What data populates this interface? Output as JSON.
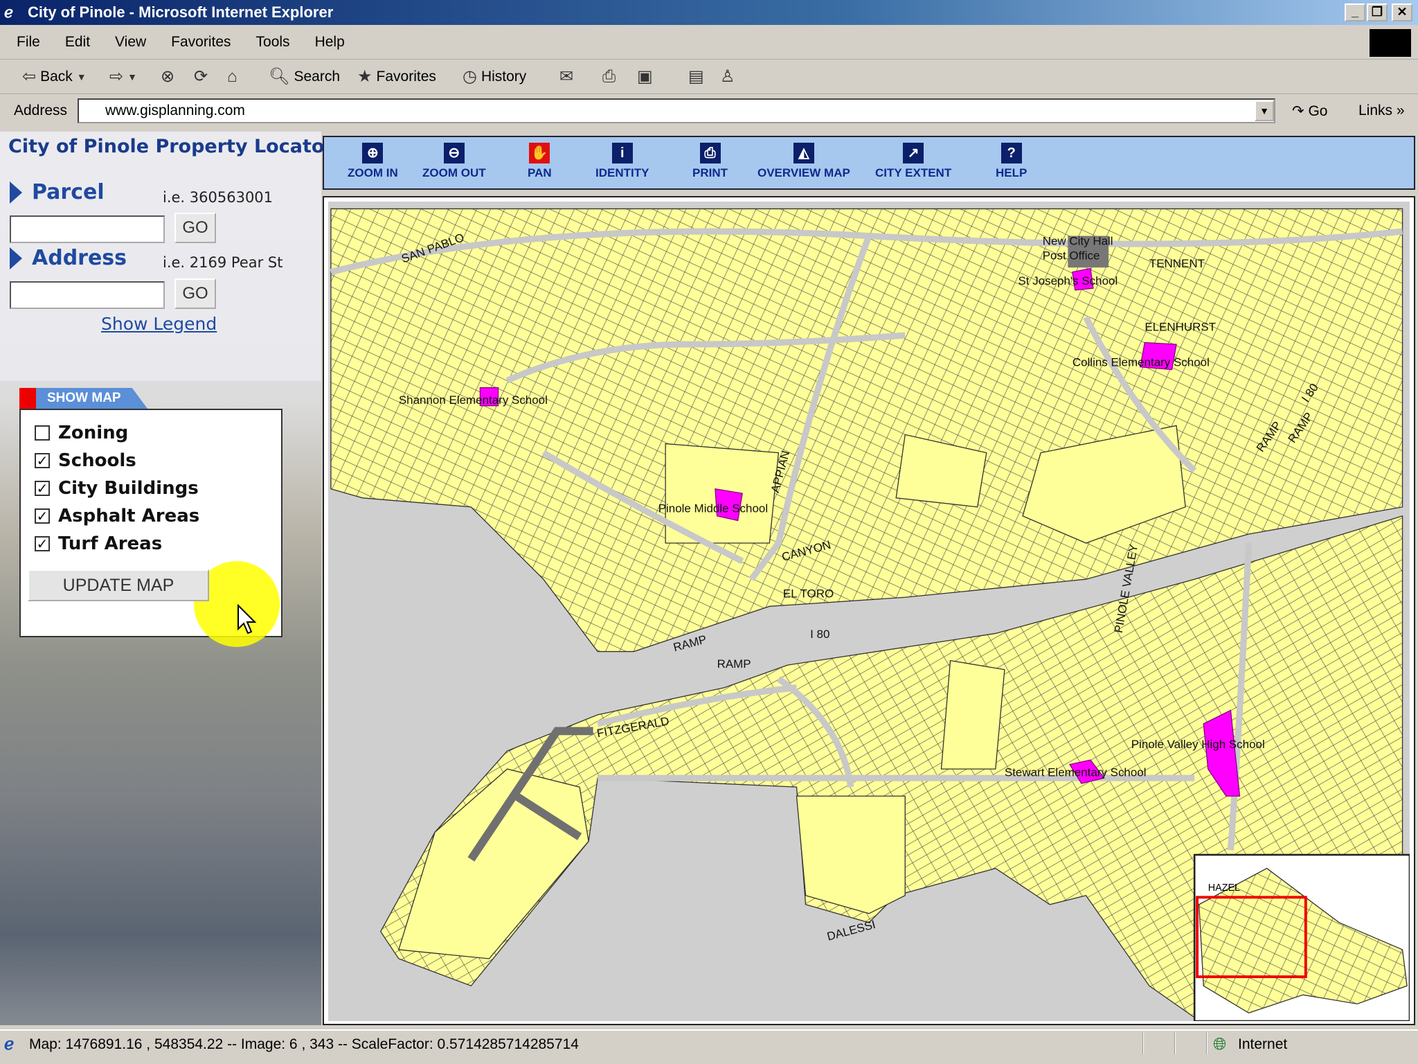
{
  "window": {
    "title": "City of Pinole - Microsoft Internet Explorer"
  },
  "menu": [
    "File",
    "Edit",
    "View",
    "Favorites",
    "Tools",
    "Help"
  ],
  "toolbar": {
    "back": "Back",
    "search": "Search",
    "favorites": "Favorites",
    "history": "History"
  },
  "address": {
    "label": "Address",
    "url": "www.gisplanning.com",
    "go": "Go",
    "links": "Links"
  },
  "app": {
    "title": "City of Pinole Property Locator",
    "parcel": {
      "label": "Parcel",
      "hint": "i.e. 360563001",
      "value": "",
      "go": "GO"
    },
    "address": {
      "label": "Address",
      "hint": "i.e. 2169 Pear St",
      "value": "",
      "go": "GO"
    },
    "show_legend": "Show Legend",
    "show_map_tab": "SHOW MAP",
    "layers": [
      {
        "label": "Zoning",
        "checked": false
      },
      {
        "label": "Schools",
        "checked": true
      },
      {
        "label": "City Buildings",
        "checked": true
      },
      {
        "label": "Asphalt Areas",
        "checked": true
      },
      {
        "label": "Turf Areas",
        "checked": true
      }
    ],
    "update": "UPDATE MAP"
  },
  "tools": [
    {
      "label": "ZOOM IN",
      "icon": "zoom-in-icon"
    },
    {
      "label": "ZOOM OUT",
      "icon": "zoom-out-icon"
    },
    {
      "label": "PAN",
      "icon": "hand-icon"
    },
    {
      "label": "IDENTITY",
      "icon": "info-icon"
    },
    {
      "label": "PRINT",
      "icon": "print-icon"
    },
    {
      "label": "OVERVIEW MAP",
      "icon": "overview-icon"
    },
    {
      "label": "CITY EXTENT",
      "icon": "extent-icon"
    },
    {
      "label": "HELP",
      "icon": "help-icon"
    }
  ],
  "map": {
    "colors": {
      "land": "#ffff99",
      "school": "#ff00ff",
      "road": "#c8c8c8",
      "asphalt": "#707070"
    },
    "labels": {
      "shannon": "Shannon Elementary School",
      "pinole_middle": "Pinole Middle School",
      "collins": "Collins Elementary School",
      "stewart": "Stewart Elementary School",
      "pinole_valley": "Pinole Valley High School",
      "city_hall": "New City Hall",
      "post_office": "Post Office",
      "st_joseph": "St Joseph's School",
      "ramp1": "RAMP",
      "ramp2": "RAMP",
      "ramp3": "RAMP",
      "ramp4": "RAMP",
      "i80a": "I 80",
      "i80b": "I 80",
      "fitzgerald": "FITZGERALD",
      "san_pablo": "SAN PABLO",
      "appian": "APPIAN",
      "pinole_valley_rd": "PINOLE VALLEY",
      "tennent": "TENNENT",
      "dalessi": "DALESSI",
      "elenhurst": "ELENHURST",
      "el_toro": "EL TORO",
      "canyon": "CANYON",
      "hazel": "HAZEL"
    }
  },
  "status": {
    "text": "Map: 1476891.16 , 548354.22 -- Image: 6 , 343 -- ScaleFactor: 0.5714285714285714",
    "zone": "Internet"
  }
}
